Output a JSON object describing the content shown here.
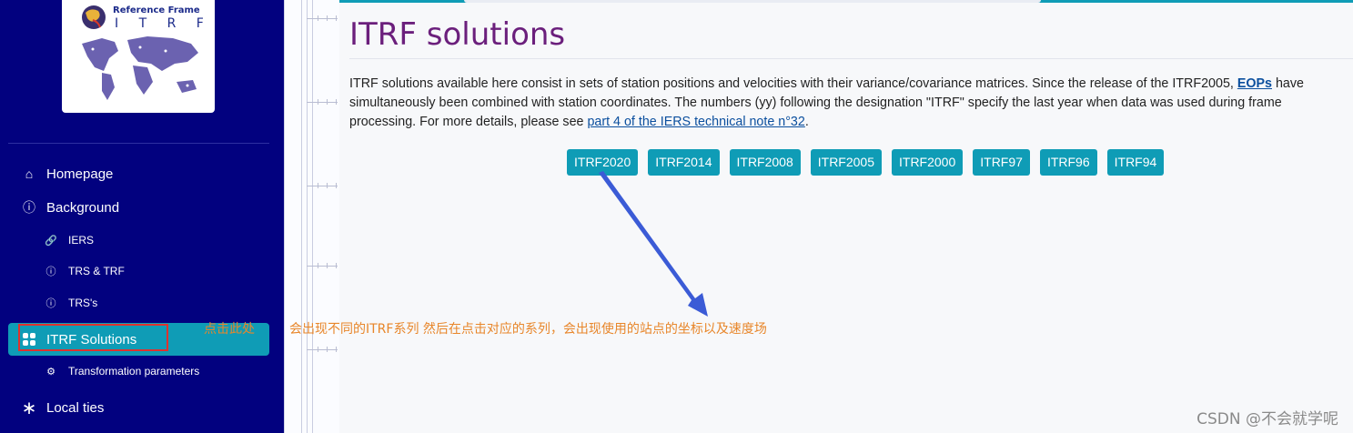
{
  "logo": {
    "line1": "Reference Frame",
    "line2": "I T R F"
  },
  "sidebar": {
    "items": [
      {
        "label": "Homepage",
        "icon": "home-icon"
      },
      {
        "label": "Background",
        "icon": "info-icon"
      },
      {
        "label": "IERS",
        "icon": "link-icon"
      },
      {
        "label": "TRS & TRF",
        "icon": "info-icon"
      },
      {
        "label": "TRS's",
        "icon": "info-icon"
      },
      {
        "label": "ITRF Solutions",
        "icon": "grid-icon"
      },
      {
        "label": "Transformation parameters",
        "icon": "gear-icon"
      },
      {
        "label": "Local ties",
        "icon": "asterisk-icon"
      }
    ]
  },
  "main": {
    "title": "ITRF solutions",
    "intro_part1": "ITRF solutions available here consist in sets of station positions and velocities with their variance/covariance matrices. Since the release of the ITRF2005, ",
    "eop_link": "EOPs",
    "intro_part2": " have simultaneously been combined with station coordinates. The numbers (yy) following the designation \"ITRF\" specify the last year when data was used during frame processing. For more details, please see ",
    "note_link": "part 4 of the IERS technical note n°32",
    "intro_end": ".",
    "buttons": [
      "ITRF2020",
      "ITRF2014",
      "ITRF2008",
      "ITRF2005",
      "ITRF2000",
      "ITRF97",
      "ITRF96",
      "ITRF94"
    ]
  },
  "annotations": {
    "click_here": "点击此处",
    "explain": "会出现不同的ITRF系列   然后在点击对应的系列，会出现使用的站点的坐标以及速度场"
  },
  "watermark": "CSDN @不会就学呢",
  "colors": {
    "sidebar_bg": "#02017f",
    "accent": "#0f9cb6",
    "title": "#6b1f7c",
    "annotation": "#e8862a",
    "highlight_box": "#e0322d",
    "arrow": "#3b5bd6"
  }
}
